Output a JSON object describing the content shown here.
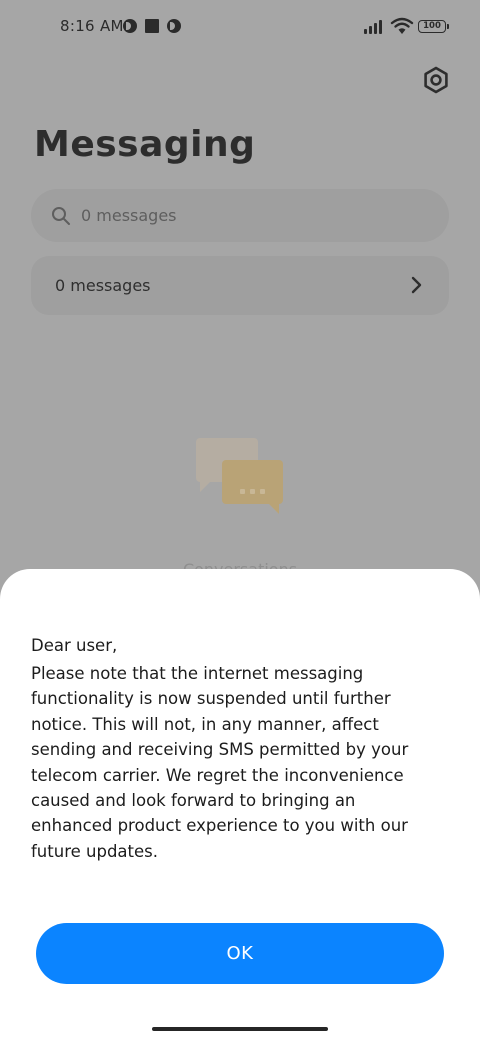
{
  "status_bar": {
    "time": "8:16 AM",
    "battery": "100",
    "icons": [
      "notification-icon",
      "notification-icon",
      "app-square-icon",
      "signal-icon",
      "wifi-icon",
      "battery-icon"
    ]
  },
  "header": {
    "title": "Messaging",
    "settings_icon": "settings-icon"
  },
  "search": {
    "placeholder": "0 messages",
    "icon": "search-icon"
  },
  "conversation_row": {
    "label": "0 messages",
    "icon": "chevron-right-icon"
  },
  "empty_state": {
    "icon": "chat-bubbles-icon",
    "text": "Conversations"
  },
  "dialog": {
    "greeting": "Dear user,",
    "body": "Please note that the internet messaging\nfunctionality is now suspended until further\nnotice. This will not, in any manner, affect\nsending and receiving SMS permitted by your\ntelecom carrier. We regret the inconvenience\ncaused and look forward to bringing an\nenhanced product experience to you with our\nfuture updates.",
    "ok_label": "OK"
  },
  "colors": {
    "accent": "#0b84ff",
    "scrim_background": "#a6a6a6",
    "sheet_background": "#ffffff"
  }
}
